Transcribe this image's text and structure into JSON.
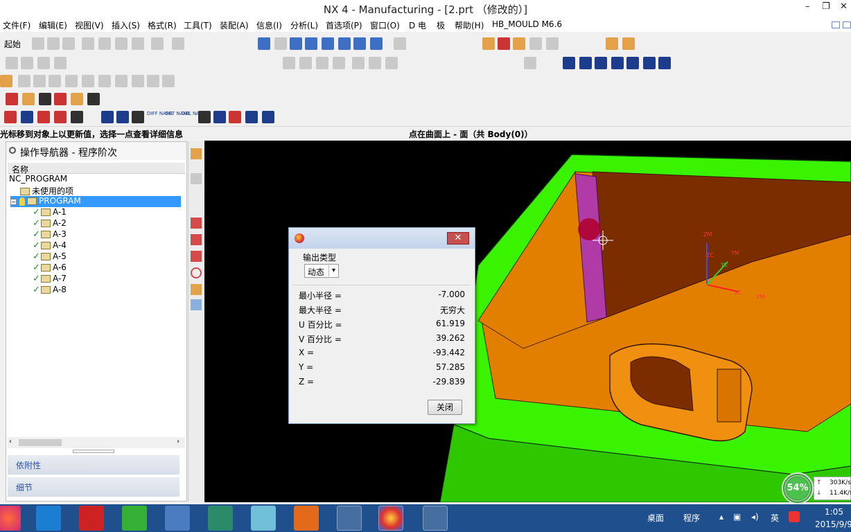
{
  "window": {
    "title": "NX 4 - Manufacturing - [2.prt （修改的）]",
    "minimize_glyph": "–",
    "restore_glyph": "❐",
    "close_glyph": "✕"
  },
  "menubar": {
    "items": [
      "文件(F)",
      "编辑(E)",
      "视图(V)",
      "插入(S)",
      "格式(R)",
      "工具(T)",
      "装配(A)",
      "信息(I)",
      "分析(L)",
      "首选项(P)",
      "窗口(O)",
      "D 电",
      "极",
      "帮助(H)",
      "HB_MOULD M6.6"
    ]
  },
  "toolbar": {
    "start_label": "起始",
    "text_icons": [
      "DIFF NAME",
      "GET NAME",
      "DEL NAME"
    ]
  },
  "cue_line": {
    "left": "光标移到对象上以更新值，选择一点查看详细信息",
    "right": "点在曲面上 - 面（共 Body(0)）"
  },
  "navigator": {
    "title": "操作导航器 - 程序阶次",
    "column_header": "名称",
    "root": "NC_PROGRAM",
    "unused": "未使用的项",
    "program": "PROGRAM",
    "operations": [
      "A-1",
      "A-2",
      "A-3",
      "A-4",
      "A-5",
      "A-6",
      "A-7",
      "A-8"
    ],
    "tab_dependency": "依附性",
    "tab_details": "细节"
  },
  "dialog": {
    "group_label": "输出类型",
    "output_type_value": "动态",
    "readout": [
      {
        "label": "最小半径 =",
        "value": "-7.000"
      },
      {
        "label": "最大半径 =",
        "value": "无穷大"
      },
      {
        "label": "U 百分比 =",
        "value": "61.919"
      },
      {
        "label": "V 百分比 =",
        "value": "39.262"
      },
      {
        "label": "X =",
        "value": "-93.442"
      },
      {
        "label": "Y =",
        "value": "57.285"
      },
      {
        "label": "Z =",
        "value": "-29.839"
      }
    ],
    "close_label": "关闭",
    "close_glyph": "✕"
  },
  "viewport": {
    "axis_labels": [
      "ZM",
      "YM",
      "XM",
      "ZC",
      "YC",
      "XC"
    ],
    "colors": {
      "frame": "#39f300",
      "pocket": "#e37f00",
      "wall": "#7c2d00",
      "cylinder": "#b03aa6"
    }
  },
  "net_monitor": {
    "percent": "54%",
    "upload": "303K/s",
    "download": "11.4K/s"
  },
  "taskbar": {
    "desktop_label": "桌面",
    "program_label": "程序",
    "ime_label": "英",
    "time": "1:05",
    "date": "2015/9/9"
  }
}
